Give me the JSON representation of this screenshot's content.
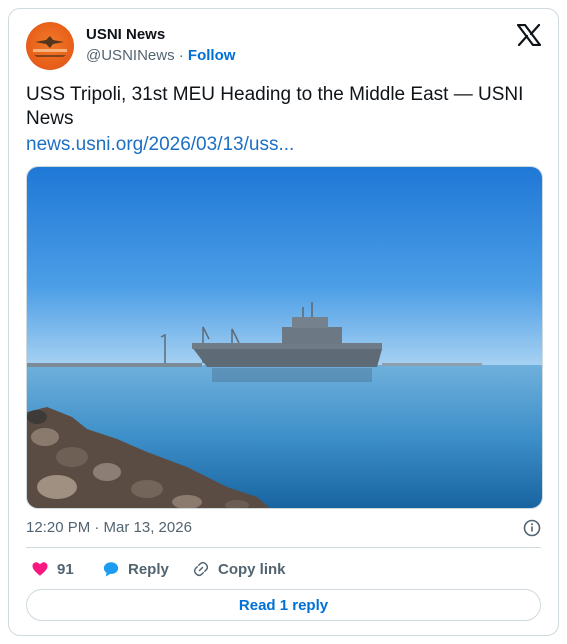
{
  "author": {
    "name": "USNI News",
    "handle": "@USNINews",
    "separator": "·",
    "follow_label": "Follow"
  },
  "post": {
    "title": "USS Tripoli, 31st MEU Heading to the Middle East — USNI News",
    "link": "news.usni.org/2026/03/13/uss...",
    "image_description": "USS Tripoli",
    "timestamp": "12:20 PM · Mar 13, 2026"
  },
  "actions": {
    "likes": "91",
    "reply_label": "Reply",
    "copy_label": "Copy link"
  },
  "read_replies_label": "Read 1 reply",
  "colors": {
    "accent": "#006fd6",
    "like": "#f91880",
    "reply": "#1d9bf0",
    "muted": "#536471"
  }
}
